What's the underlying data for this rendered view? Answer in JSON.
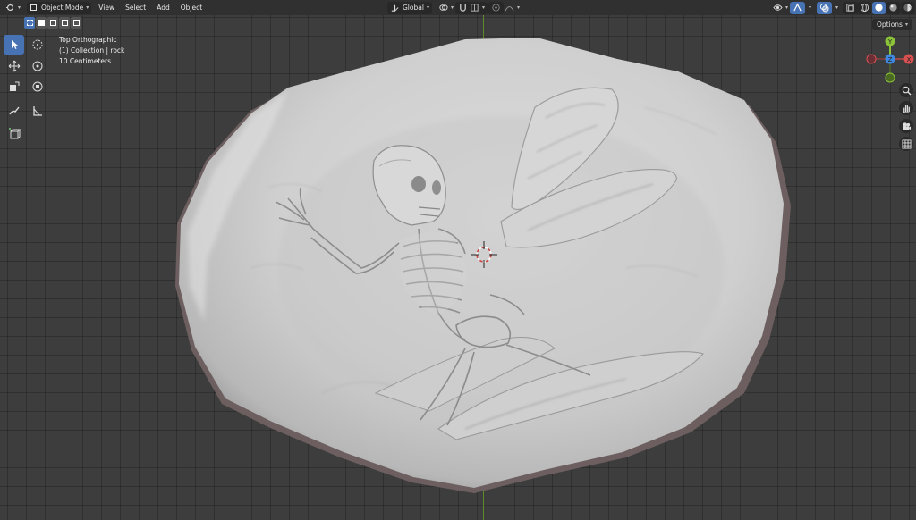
{
  "header": {
    "mode_label": "Object Mode",
    "menus": [
      "View",
      "Select",
      "Add",
      "Object"
    ],
    "transform_orientation": "Global"
  },
  "viewport": {
    "view_name": "Top Orthographic",
    "collection_info": "(1) Collection | rock",
    "scale_info": "10 Centimeters",
    "options_label": "Options"
  },
  "gizmo": {
    "axes": [
      "X",
      "Y",
      "Z"
    ],
    "colors": {
      "x": "#e04b4b",
      "y": "#8bc23a",
      "z": "#3f88e0"
    }
  },
  "icons": {
    "editor_type": "3d-viewport-icon",
    "tools": [
      "select-box-icon",
      "cursor-icon",
      "move-icon",
      "rotate-icon",
      "scale-icon",
      "transform-icon",
      "annotate-icon",
      "measure-icon",
      "add-cube-icon"
    ],
    "nav": [
      "zoom-icon",
      "pan-hand-icon",
      "camera-icon",
      "grid-icon"
    ]
  },
  "colors": {
    "accent": "#4772b3",
    "header_bg": "#303030",
    "viewport_bg": "#3d3d3d",
    "x_axis": "#8a3b3b",
    "y_axis": "#5e8a2a"
  }
}
